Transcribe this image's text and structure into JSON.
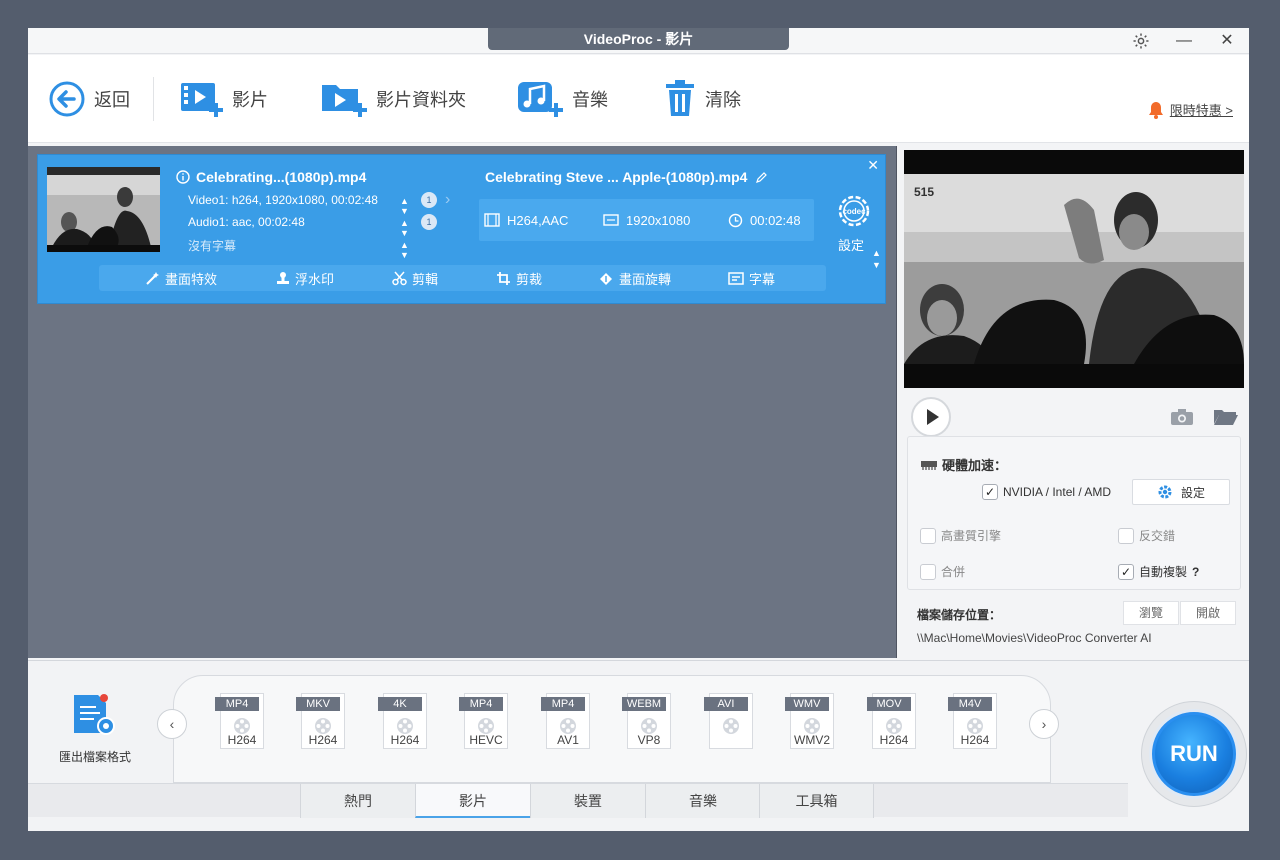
{
  "window": {
    "title": "VideoProc - 影片"
  },
  "toolbar": {
    "back": "返回",
    "video": "影片",
    "video_folder": "影片資料夾",
    "music": "音樂",
    "clear": "清除",
    "promo": "限時特惠 >"
  },
  "task": {
    "source_title": "Celebrating...(1080p).mp4",
    "video_track": "Video1: h264, 1920x1080, 00:02:48",
    "audio_track": "Audio1: aac, 00:02:48",
    "subtitle_track": "沒有字幕",
    "video_track_count": "1",
    "audio_track_count": "1",
    "output_title": "Celebrating Steve ... Apple-(1080p).mp4",
    "output_codec": "H264,AAC",
    "output_resolution": "1920x1080",
    "output_duration": "00:02:48",
    "codec_label": "codec",
    "codec_setting": "設定",
    "effects": {
      "effect": "畫面特效",
      "watermark": "浮水印",
      "cut": "剪輯",
      "crop": "剪裁",
      "rotate": "畫面旋轉",
      "subtitle": "字幕"
    }
  },
  "settings": {
    "hw_accel": "硬體加速：",
    "nvidia": "NVIDIA / Intel / AMD",
    "nvidia_checked": true,
    "setting_button": "設定",
    "hq_engine": "高畫質引擎",
    "deinterlace": "反交錯",
    "merge": "合併",
    "auto_copy": "自動複製",
    "auto_copy_checked": true,
    "help_mark": "?",
    "save_location": "檔案儲存位置：",
    "browse": "瀏覽",
    "open": "開啟",
    "path": "\\\\Mac\\Home\\Movies\\VideoProc Converter AI"
  },
  "formats": {
    "export_label": "匯出檔案格式",
    "items": [
      {
        "tag": "MP4",
        "sub": "H264"
      },
      {
        "tag": "MKV",
        "sub": "H264"
      },
      {
        "tag": "4K",
        "sub": "H264"
      },
      {
        "tag": "MP4",
        "sub": "HEVC"
      },
      {
        "tag": "MP4",
        "sub": "AV1"
      },
      {
        "tag": "WEBM",
        "sub": "VP8"
      },
      {
        "tag": "AVI",
        "sub": ""
      },
      {
        "tag": "WMV",
        "sub": "WMV2"
      },
      {
        "tag": "MOV",
        "sub": "H264"
      },
      {
        "tag": "M4V",
        "sub": "H264"
      }
    ]
  },
  "tabs": [
    "熱門",
    "影片",
    "裝置",
    "音樂",
    "工具箱"
  ],
  "run_label": "RUN",
  "colors": {
    "accent": "#3a9de7",
    "window_bg": "#545d6d",
    "work_area": "#6c7483",
    "promo_bell": "#f26b2a"
  }
}
